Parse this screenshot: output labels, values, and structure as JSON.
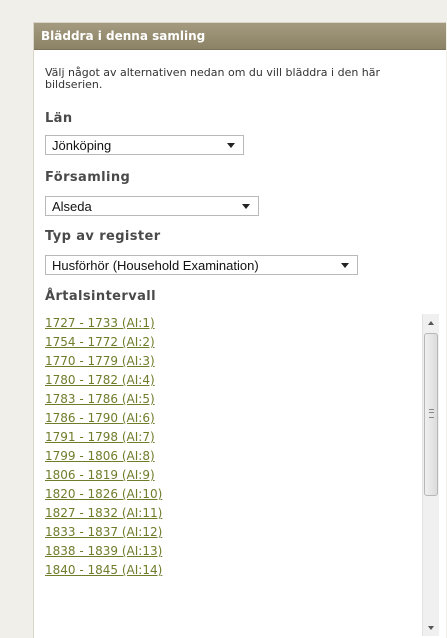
{
  "panel": {
    "title": "Bläddra i denna samling",
    "intro": "Välj något av alternativen nedan om du vill bläddra i den här bildserien."
  },
  "filters": {
    "lan": {
      "label": "Län",
      "selected": "Jönköping"
    },
    "forsamling": {
      "label": "Församling",
      "selected": "Alseda"
    },
    "typ": {
      "label": "Typ av register",
      "selected": "Husförhör (Household Examination)"
    }
  },
  "years": {
    "label": "Årtalsintervall",
    "items": [
      "1727 - 1733 (AI:1)",
      "1754 - 1772 (AI:2)",
      "1770 - 1779 (AI:3)",
      "1780 - 1782 (AI:4)",
      "1783 - 1786 (AI:5)",
      "1786 - 1790 (AI:6)",
      "1791 - 1798 (AI:7)",
      "1799 - 1806 (AI:8)",
      "1806 - 1819 (AI:9)",
      "1820 - 1826 (AI:10)",
      "1827 - 1832 (AI:11)",
      "1833 - 1837 (AI:12)",
      "1838 - 1839 (AI:13)",
      "1840 - 1845 (AI:14)"
    ]
  },
  "colors": {
    "header_bg": "#958c70",
    "link": "#6f7d2b"
  }
}
